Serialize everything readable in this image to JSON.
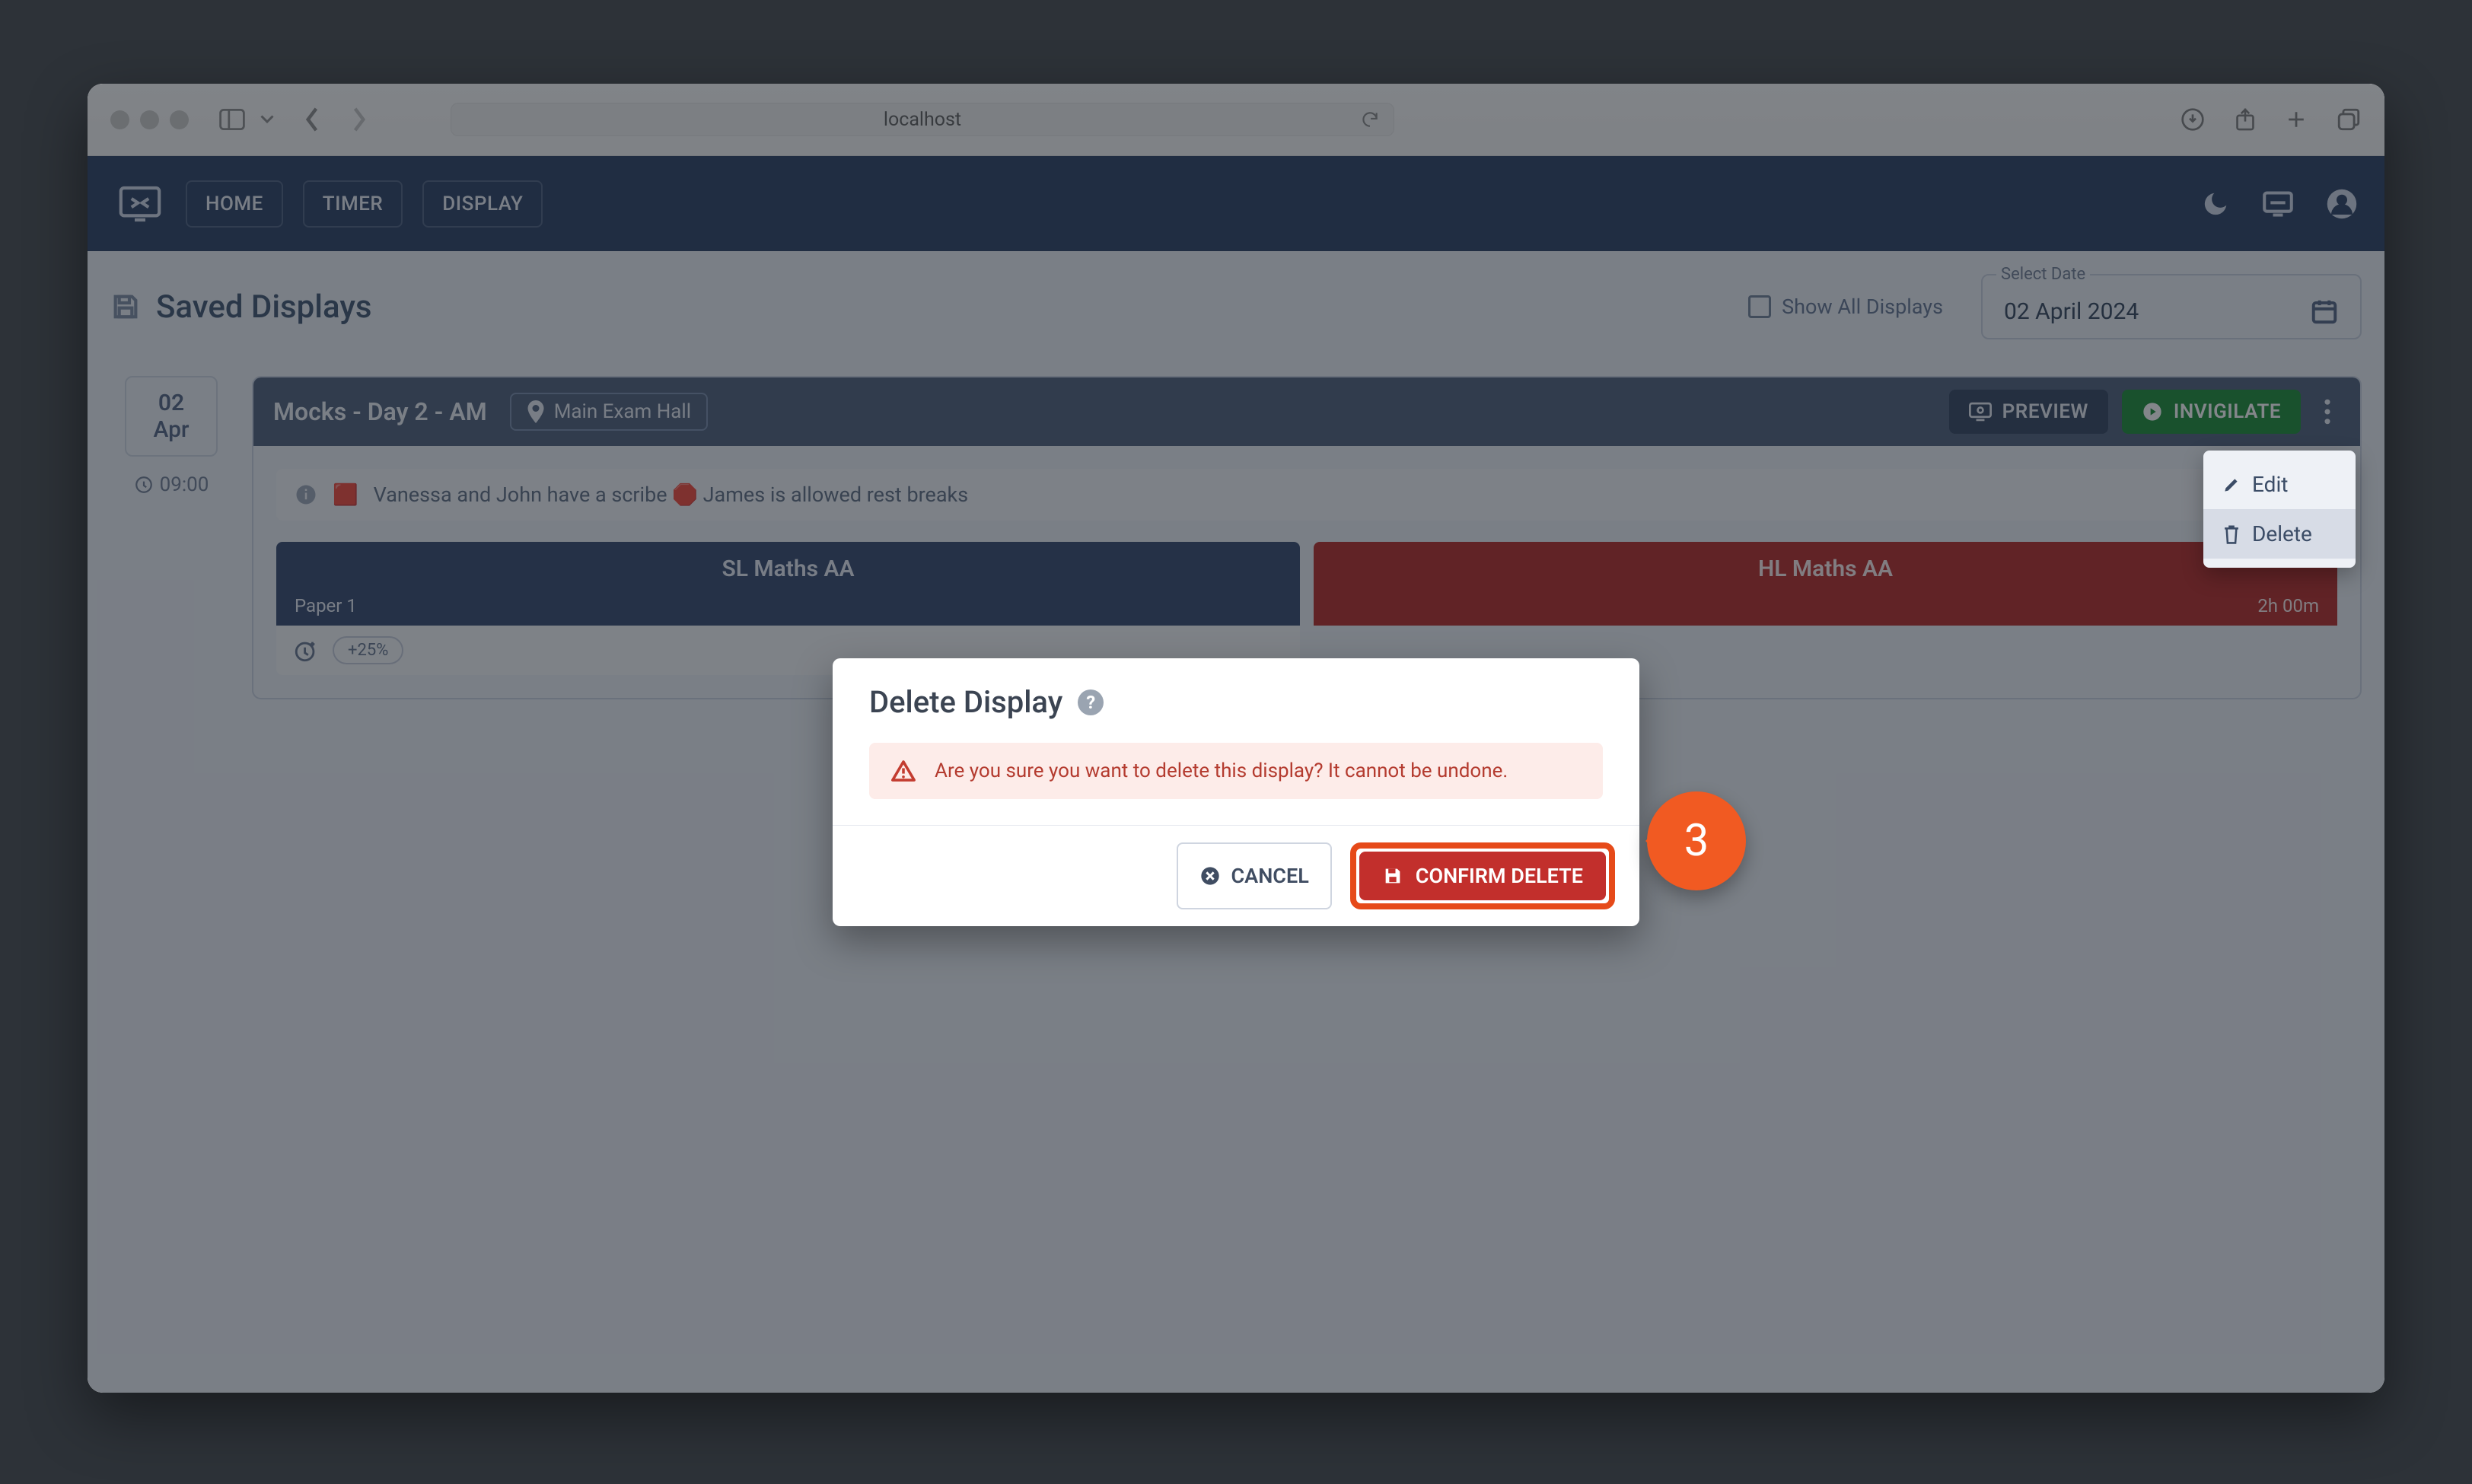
{
  "browser": {
    "address": "localhost"
  },
  "nav": {
    "home": "HOME",
    "timer": "TIMER",
    "display": "DISPLAY"
  },
  "page": {
    "title": "Saved Displays",
    "show_all": "Show All Displays",
    "date_label": "Select Date",
    "date_value": "02 April 2024"
  },
  "card": {
    "date_day": "02",
    "date_month": "Apr",
    "time": "09:00",
    "title": "Mocks - Day 2 - AM",
    "location": "Main Exam Hall",
    "preview": "PREVIEW",
    "invigilate": "INVIGILATE",
    "note": "Vanessa and John have a scribe 🛑 James is allowed rest breaks",
    "menu_edit": "Edit",
    "menu_delete": "Delete",
    "exam_sl_title": "SL Maths AA",
    "exam_sl_paper": "Paper 1",
    "exam_hl_title": "HL Maths AA",
    "exam_hl_duration": "2h 00m",
    "extra_pct": "+25%"
  },
  "modal": {
    "title": "Delete Display",
    "warning": "Are you sure you want to delete this display? It cannot be undone.",
    "cancel": "CANCEL",
    "confirm": "CONFIRM DELETE"
  },
  "step": "3"
}
